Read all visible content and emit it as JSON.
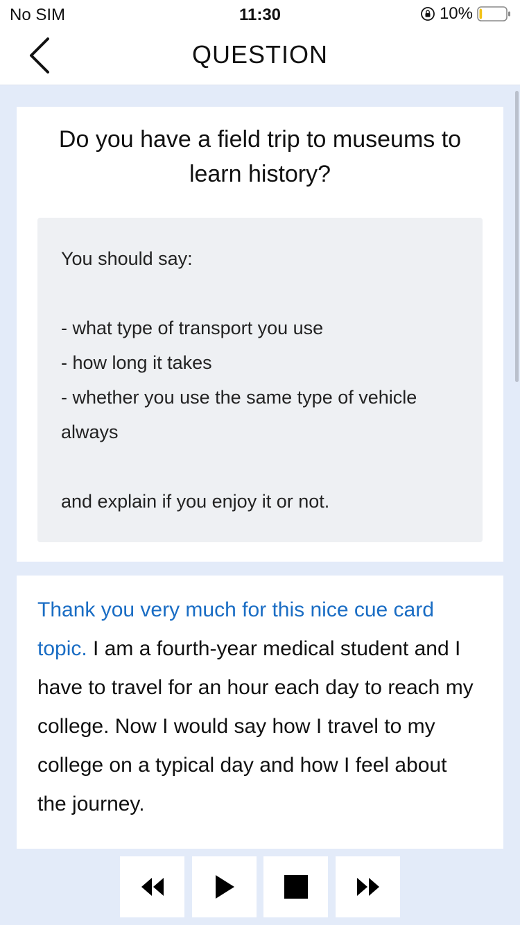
{
  "status_bar": {
    "carrier": "No SIM",
    "time": "11:30",
    "battery_percent": "10%",
    "battery_level": 0.1,
    "icons": [
      "orientation-lock-icon",
      "battery-icon"
    ]
  },
  "nav": {
    "back_icon": "chevron-left-icon",
    "title": "QUESTION"
  },
  "question": {
    "title": "Do you have a field trip to museums to learn history?",
    "cue_card": "You should say:\n\n- what type of transport you use\n- how long it takes\n- whether you use the same type of vehicle always\n\nand explain if you enjoy it or not."
  },
  "answer": {
    "highlight": "Thank you very much for this nice cue card topic.",
    "body": " I am a fourth-year medical student and I have to travel for an hour each day to reach my college. Now I would say how I travel to my college on a typical day and how I feel about the journey."
  },
  "player": {
    "buttons": [
      "rewind-icon",
      "play-icon",
      "stop-icon",
      "fast-forward-icon"
    ]
  },
  "colors": {
    "background": "#e3ebf9",
    "card": "#ffffff",
    "cue_box": "#eef0f3",
    "accent": "#1a6dc4",
    "battery_fill": "#f2c318"
  }
}
